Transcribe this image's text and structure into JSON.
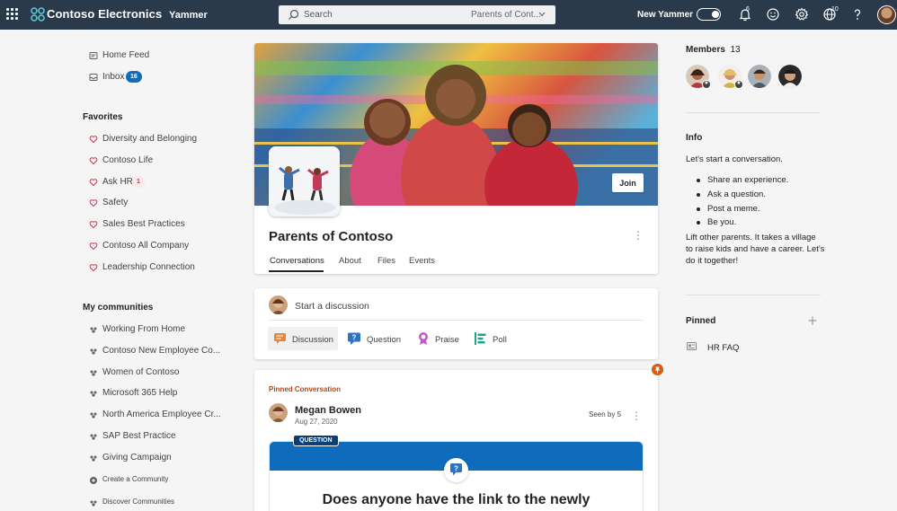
{
  "topbar": {
    "brand": "Contoso Electronics",
    "app": "Yammer",
    "search_placeholder": "Search",
    "search_scope": "Parents of Cont...",
    "new_yammer_label": "New Yammer",
    "notifications_count": "6",
    "globe_count": "10",
    "icons": [
      "app-launcher-icon",
      "contoso-logo-icon",
      "search-icon",
      "chevron-down-icon",
      "bell-icon",
      "smiley-icon",
      "gear-icon",
      "globe-icon",
      "help-icon"
    ]
  },
  "nav": {
    "home_feed": "Home Feed",
    "inbox": "Inbox",
    "inbox_count": "16",
    "favorites_title": "Favorites",
    "favorites": [
      {
        "label": "Diversity and Belonging"
      },
      {
        "label": "Contoso Life"
      },
      {
        "label": "Ask HR",
        "count": "1"
      },
      {
        "label": "Safety"
      },
      {
        "label": "Sales Best Practices"
      },
      {
        "label": "Contoso All Company"
      },
      {
        "label": "Leadership Connection"
      }
    ],
    "communities_title": "My communities",
    "communities": [
      {
        "label": "Working From Home"
      },
      {
        "label": "Contoso New Employee Co..."
      },
      {
        "label": "Women of Contoso"
      },
      {
        "label": "Microsoft 365 Help"
      },
      {
        "label": "North America Employee Cr..."
      },
      {
        "label": "SAP Best Practice"
      },
      {
        "label": "Giving Campaign"
      }
    ],
    "create_community": "Create a Community",
    "discover_communities": "Discover Communities"
  },
  "group": {
    "join_label": "Join",
    "title": "Parents of Contoso",
    "tabs": [
      "Conversations",
      "About",
      "Files",
      "Events"
    ],
    "active_tab": "Conversations"
  },
  "composer": {
    "placeholder": "Start a discussion",
    "types": [
      {
        "label": "Discussion",
        "icon": "discussion-icon"
      },
      {
        "label": "Question",
        "icon": "question-icon"
      },
      {
        "label": "Praise",
        "icon": "praise-icon"
      },
      {
        "label": "Poll",
        "icon": "poll-icon"
      }
    ]
  },
  "post": {
    "pinned_label": "Pinned Conversation",
    "author": "Megan Bowen",
    "date": "Aug 27, 2020",
    "seen_by": "Seen by 5",
    "badge": "QUESTION",
    "question_title": "Does anyone have the link to the newly"
  },
  "sidebar": {
    "members_label": "Members",
    "members_count": "13",
    "info_title": "Info",
    "info_intro": "Let's start a conversation.",
    "info_bullets": [
      "Share an experience.",
      "Ask a question.",
      "Post a meme.",
      "Be you."
    ],
    "info_outro": "Lift other parents. It takes a village to raise kids and have a career. Let's do it together!",
    "pinned_title": "Pinned",
    "pinned_items": [
      {
        "label": "HR FAQ"
      }
    ]
  },
  "colors": {
    "topbar": "#2b3a4a",
    "accent": "#0f6cbd",
    "favorite_heart": "#c4314b",
    "pinned": "#b0471a",
    "ask_hr_badge_bg": "#fde7e9"
  }
}
